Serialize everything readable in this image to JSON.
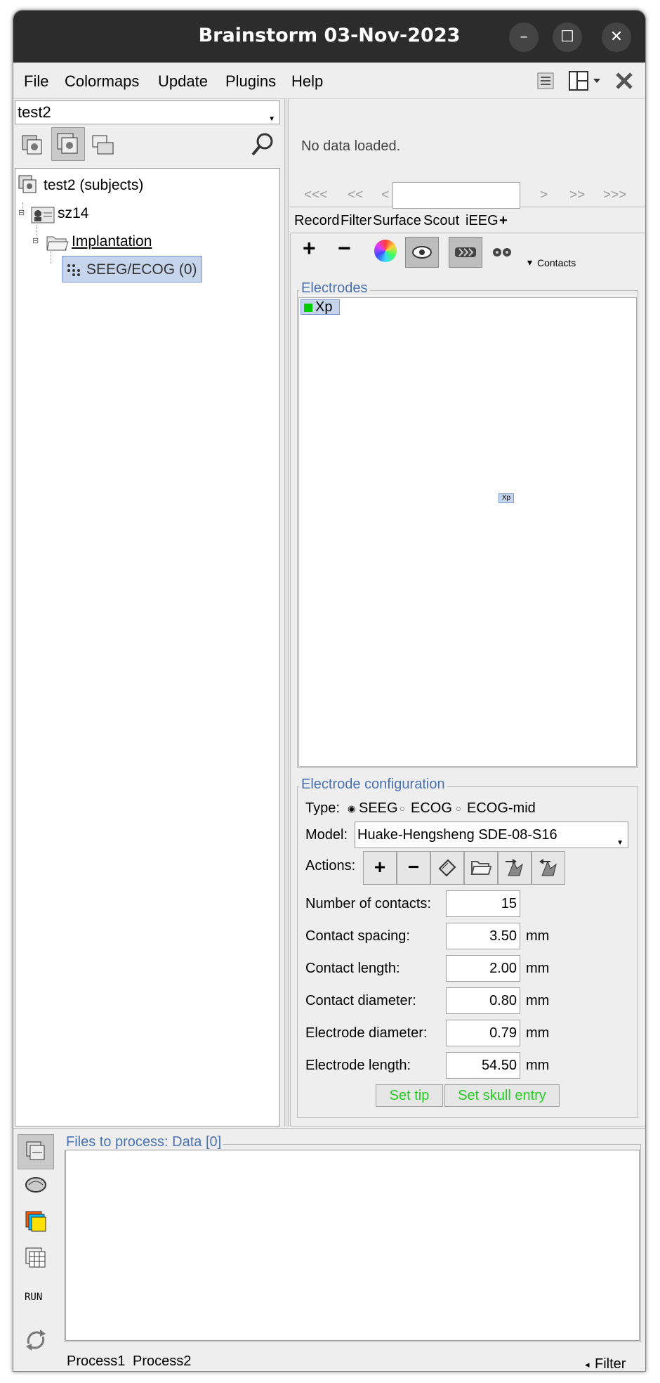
{
  "window": {
    "title": "Brainstorm 03-Nov-2023"
  },
  "menubar": {
    "items": [
      "File",
      "Colormaps",
      "Update",
      "Plugins",
      "Help"
    ]
  },
  "left": {
    "protocol_select": "test2",
    "tree": {
      "root": "test2 (subjects)",
      "subject": "sz14",
      "folder": "Implantation",
      "item": "SEEG/ECOG (0)"
    }
  },
  "time_panel": {
    "message": "No data loaded.",
    "nav": [
      "<<<",
      "<<",
      "<",
      ">",
      ">>",
      ">>>"
    ],
    "value": ""
  },
  "tabs": [
    "Record",
    "Filter",
    "Surface",
    "Scout",
    "iEEG",
    "+"
  ],
  "toolbar": {
    "add": "+",
    "remove": "−",
    "contacts_label": "Contacts",
    "dropdown_arrow": "▾"
  },
  "electrodes": {
    "legend": "Electrodes",
    "list": [
      {
        "label": "Xp",
        "color": "#00cc00"
      }
    ],
    "marker_label": "Xp"
  },
  "config": {
    "legend": "Electrode configuration",
    "type_label": "Type:",
    "types": [
      {
        "label": "SEEG",
        "selected": true
      },
      {
        "label": "ECOG",
        "selected": false
      },
      {
        "label": "ECOG-mid",
        "selected": false
      }
    ],
    "model_label": "Model:",
    "model_value": "Huake-Hengsheng SDE-08-S16",
    "actions_label": "Actions:",
    "actions": {
      "add": "+",
      "remove": "−"
    },
    "fields": [
      {
        "label": "Number of contacts:",
        "value": "15",
        "unit": ""
      },
      {
        "label": "Contact spacing:",
        "value": "3.50",
        "unit": "mm"
      },
      {
        "label": "Contact length:",
        "value": "2.00",
        "unit": "mm"
      },
      {
        "label": "Contact diameter:",
        "value": "0.80",
        "unit": "mm"
      },
      {
        "label": "Electrode diameter:",
        "value": "0.79",
        "unit": "mm"
      },
      {
        "label": "Electrode length:",
        "value": "54.50",
        "unit": "mm"
      }
    ],
    "set_tip": "Set tip",
    "set_skull": "Set skull entry",
    "button_text_color": "#22cc22"
  },
  "process": {
    "legend": "Files to process: Data [0]",
    "run": "RUN",
    "tabs": [
      "Process1",
      "Process2"
    ],
    "filter": "Filter",
    "filter_arrow": "◂"
  }
}
